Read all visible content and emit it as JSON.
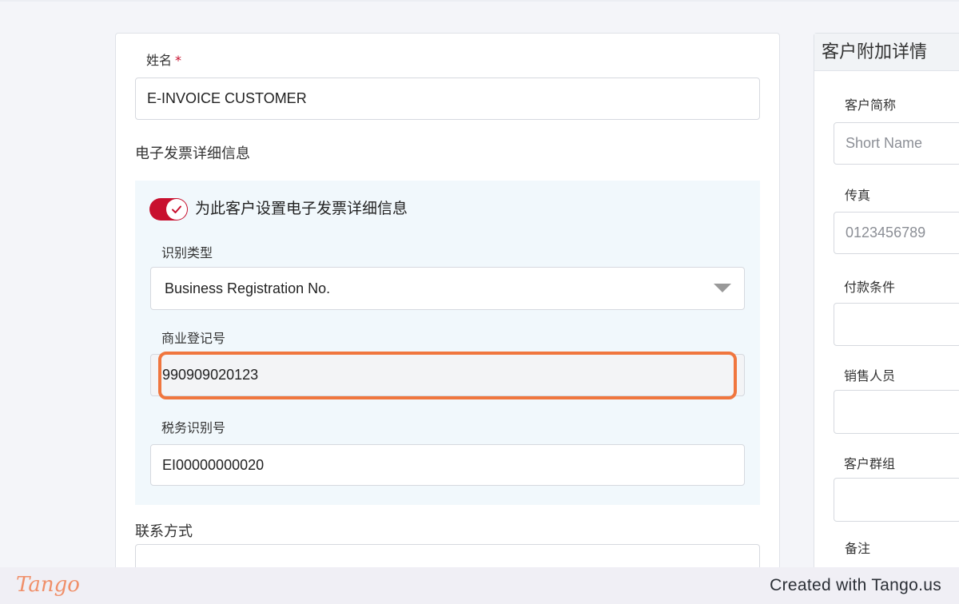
{
  "form": {
    "name_label": "姓名",
    "required_mark": "*",
    "name_value": "E-INVOICE CUSTOMER",
    "einvoice_section_title": "电子发票详细信息",
    "einvoice_toggle_label": "为此客户设置电子发票详细信息",
    "einvoice_toggle_on": true,
    "id_type_label": "识别类型",
    "id_type_value": "Business Registration No.",
    "brn_label": "商业登记号",
    "brn_value": "990909020123",
    "tin_label": "税务识别号",
    "tin_value": "EI00000000020",
    "contact_section_title": "联系方式"
  },
  "side_panel": {
    "title": "客户附加详情",
    "short_name_label": "客户简称",
    "short_name_placeholder": "Short Name",
    "fax_label": "传真",
    "fax_placeholder": "0123456789",
    "payment_terms_label": "付款条件",
    "salesperson_label": "销售人员",
    "customer_group_label": "客户群组",
    "notes_label": "备注"
  },
  "footer": {
    "logo_text": "Tango",
    "credit_text": "Created with Tango.us"
  },
  "colors": {
    "accent": "#c8102e",
    "highlight": "#f0763e",
    "panel_bg": "#f1f8fc"
  }
}
